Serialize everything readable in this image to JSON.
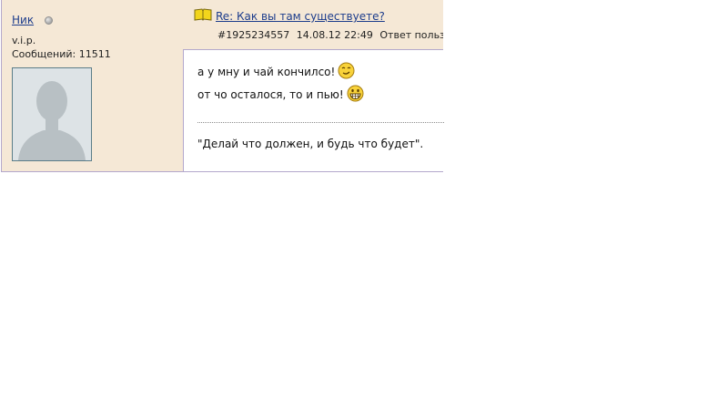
{
  "user": {
    "name": "Ник",
    "rank": "v.i.p.",
    "posts_label": "Сообщений: 11511"
  },
  "post": {
    "title": "Re: Как вы там существуете?",
    "meta": {
      "id": "#1925234557",
      "datetime": "14.08.12 22:49",
      "reply_label": "Ответ пользо"
    },
    "body_lines": [
      {
        "text": "а у мну и чай кончилсо!",
        "smiley": "smirk-smiley-icon"
      },
      {
        "text": "от чо осталося, то и пью!",
        "smiley": "grin-smiley-icon"
      }
    ],
    "signature": "\"Делай что должен, и будь что будет\"."
  },
  "colors": {
    "panel_bg": "#f5e8d6",
    "border": "#b3a8cc",
    "link": "#1d3d8c"
  }
}
